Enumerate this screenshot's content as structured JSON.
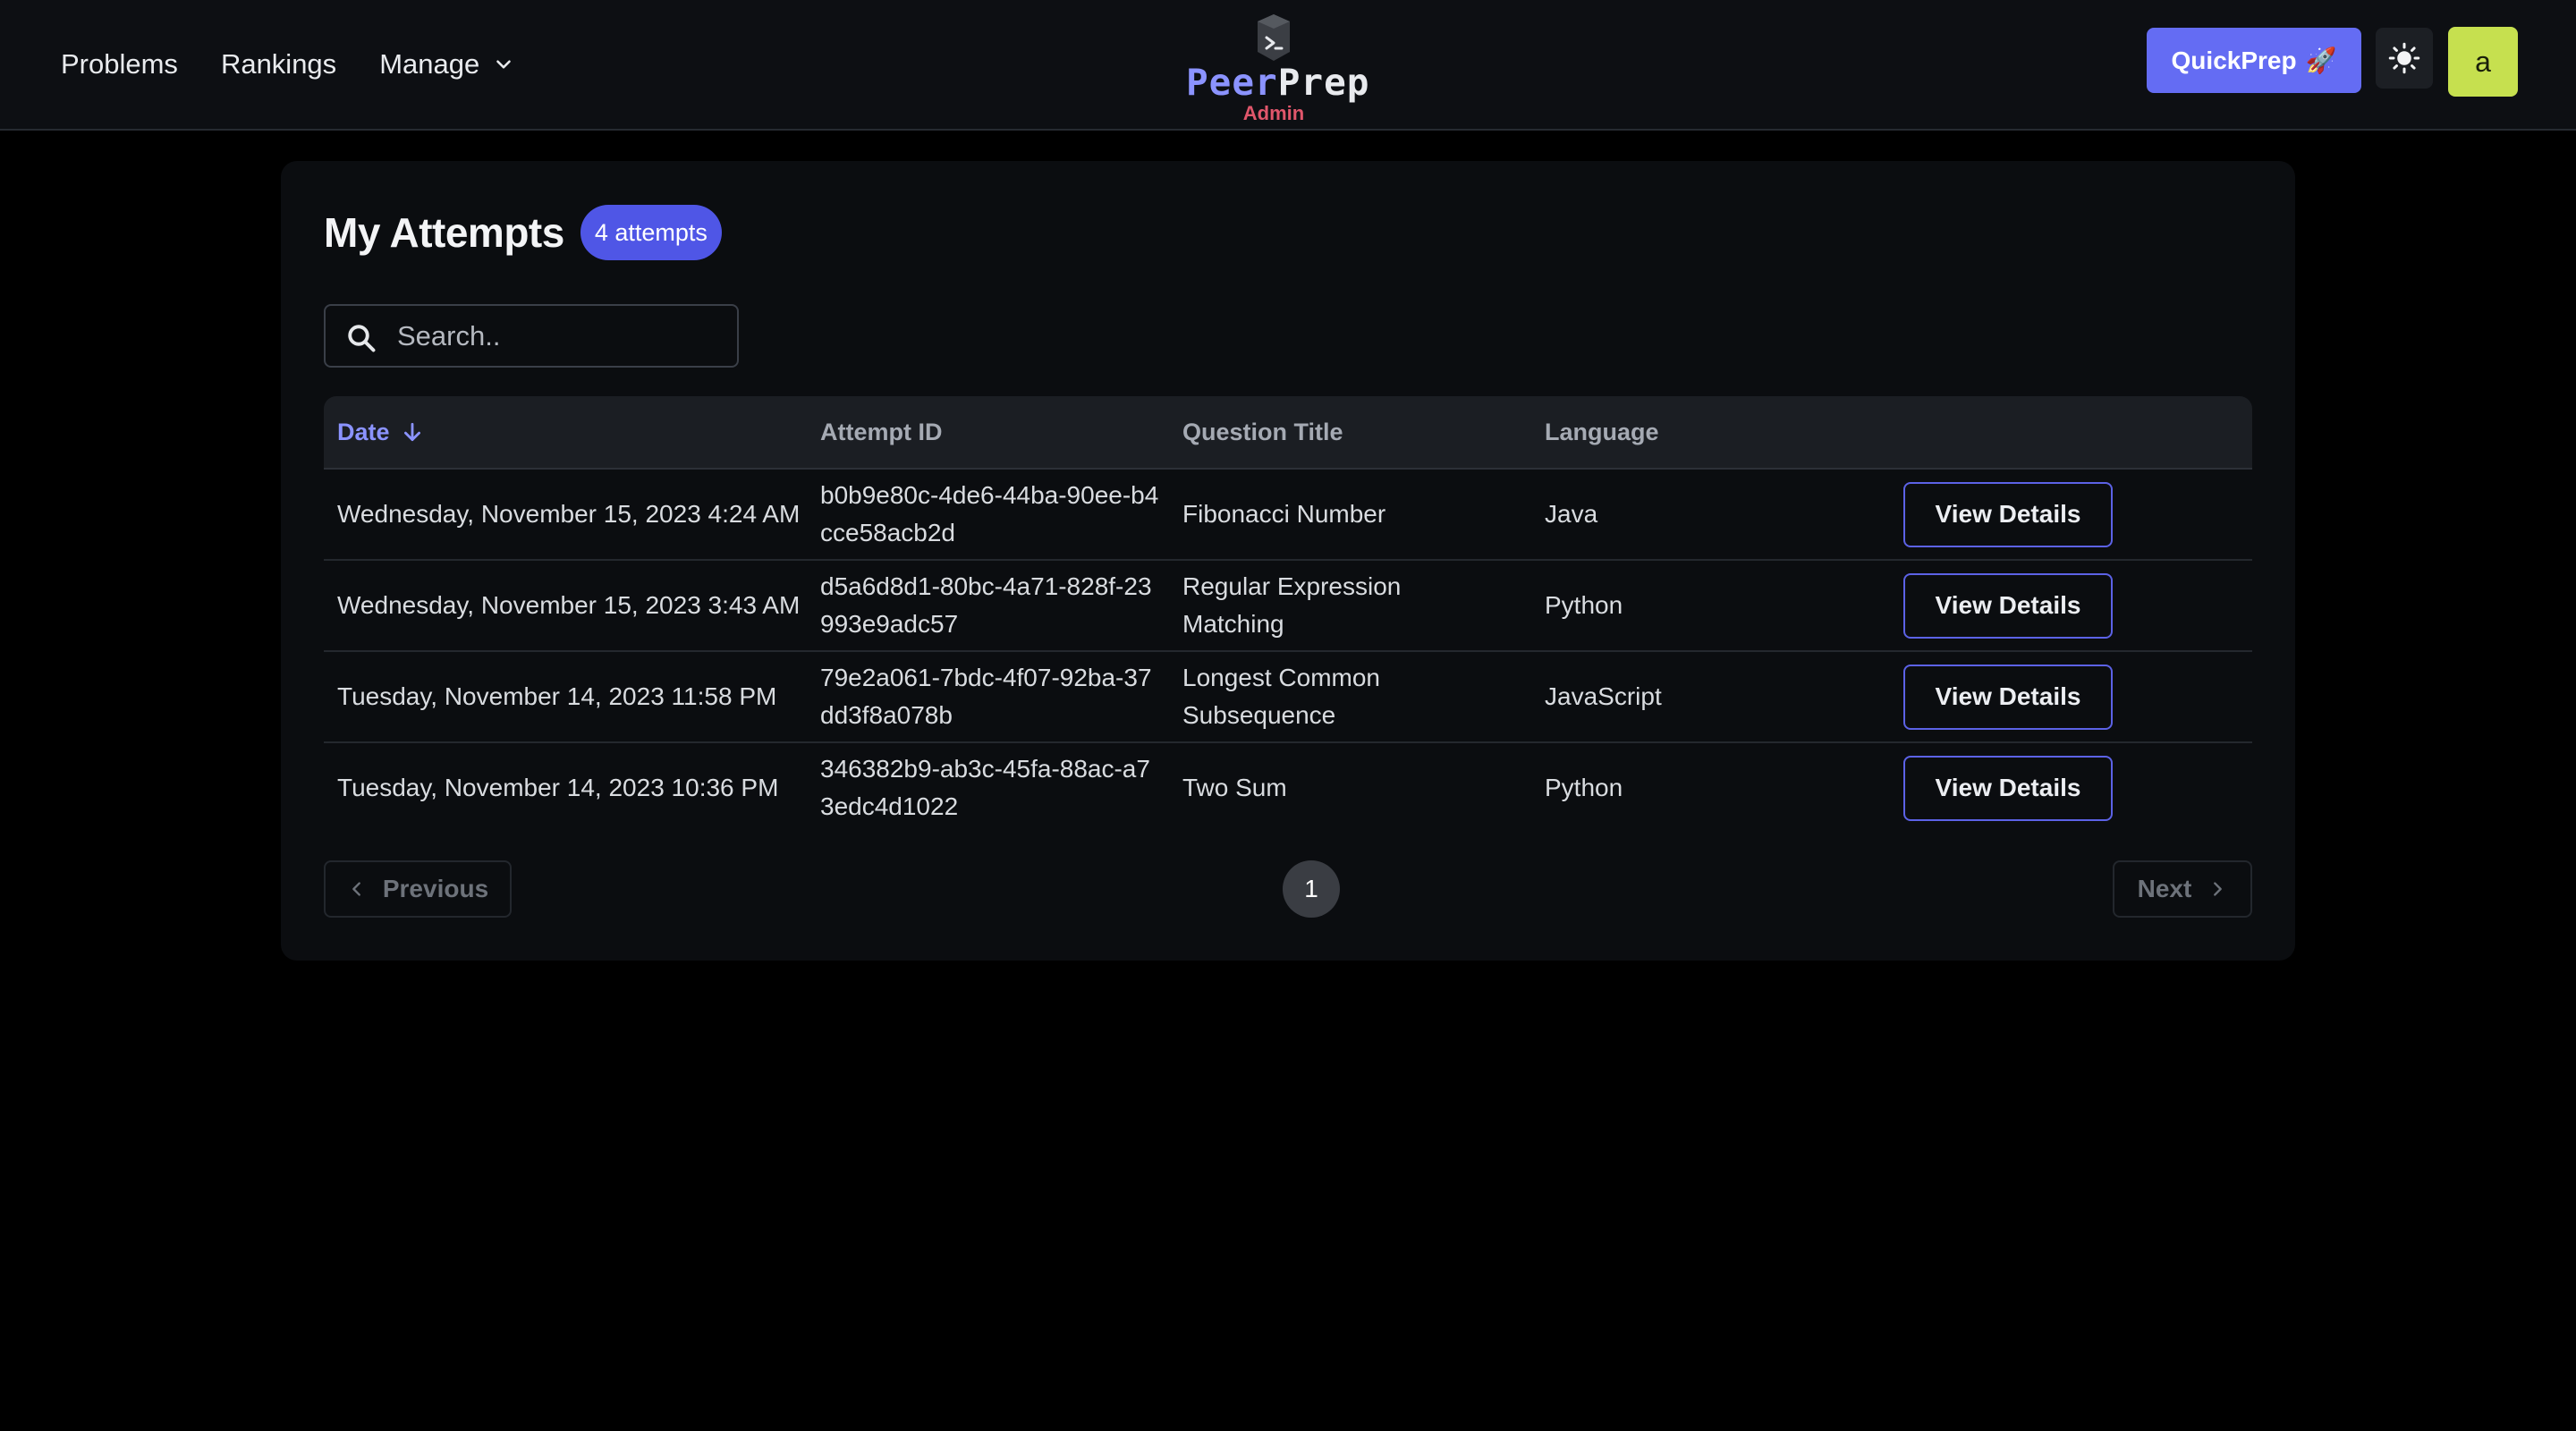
{
  "nav": {
    "links": [
      "Problems",
      "Rankings"
    ],
    "manage_label": "Manage"
  },
  "brand": {
    "peer": "Peer",
    "prep": "Prep",
    "subtitle": "Admin"
  },
  "header_actions": {
    "quickprep_label": "QuickPrep",
    "quickprep_emoji": "🚀",
    "avatar_initial": "a",
    "avatar_color": "#c6e04f",
    "accent_color": "#646cf3"
  },
  "page": {
    "title": "My Attempts",
    "count_badge": "4 attempts"
  },
  "search": {
    "placeholder": "Search.."
  },
  "table": {
    "columns": [
      "Date",
      "Attempt ID",
      "Question Title",
      "Language"
    ],
    "rows": [
      {
        "date": "Wednesday, November 15, 2023 4:24 AM",
        "attempt_id": "b0b9e80c-4de6-44ba-90ee-b4cce58acb2d",
        "question_title": "Fibonacci Number",
        "language": "Java",
        "action": "View Details"
      },
      {
        "date": "Wednesday, November 15, 2023 3:43 AM",
        "attempt_id": "d5a6d8d1-80bc-4a71-828f-23993e9adc57",
        "question_title": "Regular Expression Matching",
        "language": "Python",
        "action": "View Details"
      },
      {
        "date": "Tuesday, November 14, 2023 11:58 PM",
        "attempt_id": "79e2a061-7bdc-4f07-92ba-37dd3f8a078b",
        "question_title": "Longest Common Subsequence",
        "language": "JavaScript",
        "action": "View Details"
      },
      {
        "date": "Tuesday, November 14, 2023 10:36 PM",
        "attempt_id": "346382b9-ab3c-45fa-88ac-a73edc4d1022",
        "question_title": "Two Sum",
        "language": "Python",
        "action": "View Details"
      }
    ]
  },
  "pagination": {
    "previous_label": "Previous",
    "next_label": "Next",
    "current_page": "1"
  }
}
